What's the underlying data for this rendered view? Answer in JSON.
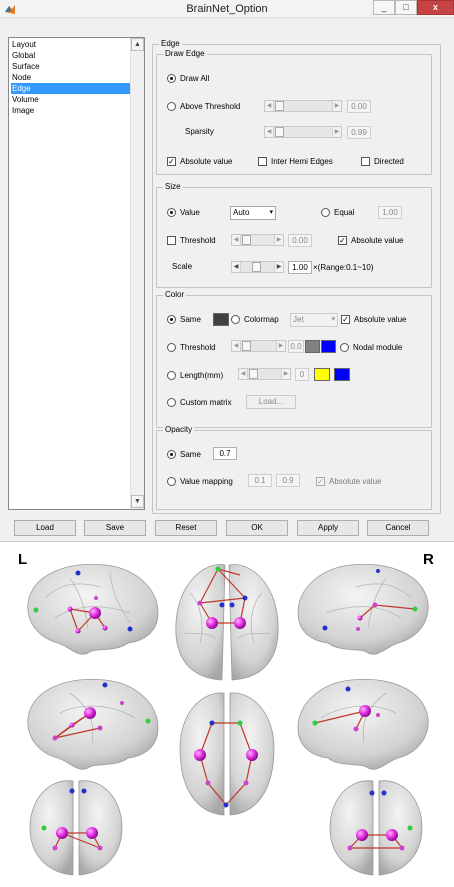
{
  "window": {
    "title": "BrainNet_Option",
    "minimize": "_",
    "maximize": "□",
    "close": "x"
  },
  "list": {
    "items": [
      "Layout",
      "Global",
      "Surface",
      "Node",
      "Edge",
      "Volume",
      "Image"
    ],
    "selected": "Edge",
    "scroll_up": "▲",
    "scroll_down": "▼"
  },
  "edge_panel": {
    "title": "Edge",
    "draw_edge": {
      "title": "Draw Edge",
      "draw_all": "Draw All",
      "above_threshold": "Above Threshold",
      "threshold_value": "0.00",
      "sparsity": "Sparsity",
      "sparsity_value": "0.99",
      "absolute_value": "Absolute value",
      "inter_hemi_edges": "Inter Hemi Edges",
      "directed": "Directed"
    },
    "size": {
      "title": "Size",
      "value": "Value",
      "value_select": "Auto",
      "equal": "Equal",
      "equal_value": "1.00",
      "threshold": "Threshold",
      "threshold_value": "0.00",
      "absolute_value": "Absolute value",
      "scale": "Scale",
      "scale_value": "1.00",
      "scale_range": "×(Range:0.1~10)"
    },
    "color": {
      "title": "Color",
      "same": "Same",
      "same_color": "#404040",
      "colormap": "Colormap",
      "colormap_select": "Jet",
      "absolute_value": "Absolute value",
      "threshold": "Threshold",
      "threshold_value": "0.0",
      "threshold_colors": [
        "#808080",
        "#0000ff"
      ],
      "nodal_module": "Nodal module",
      "length": "Length(mm)",
      "length_value": "0",
      "length_colors": [
        "#ffff00",
        "#0000ff"
      ],
      "custom_matrix": "Custom matrix",
      "load": "Load..."
    },
    "opacity": {
      "title": "Opacity",
      "same": "Same",
      "same_value": "0.7",
      "value_mapping": "Value mapping",
      "min_value": "0.1",
      "max_value": "0.9",
      "absolute_value": "Absolute value"
    }
  },
  "buttons": {
    "load": "Load",
    "save": "Save",
    "reset": "Reset",
    "ok": "OK",
    "apply": "Apply",
    "cancel": "Cancel"
  },
  "view": {
    "left_label": "L",
    "right_label": "R"
  }
}
